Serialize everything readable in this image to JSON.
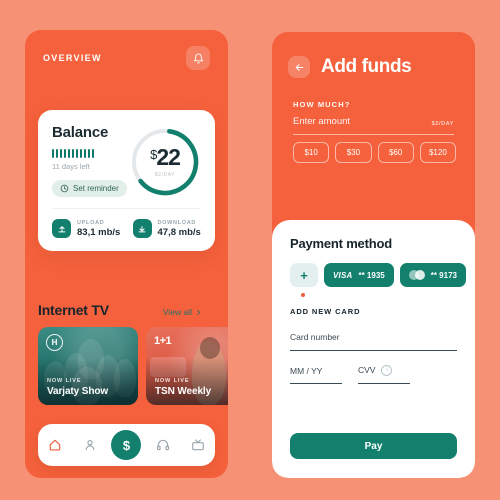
{
  "theme": {
    "page_bg": "#f79175",
    "phone_bg": "#f4613c",
    "accent_teal": "#13806e",
    "accent_coral": "#f4613c",
    "card_white": "#ffffff"
  },
  "left_screen": {
    "header": {
      "title": "OVERVIEW",
      "bell_icon": "bell-icon"
    },
    "balance_card": {
      "title": "Balance",
      "bars_count": 11,
      "days_left": "11 days left",
      "reminder_label": "Set reminder",
      "reminder_icon": "clock-icon",
      "gauge": {
        "currency": "$",
        "amount": "22",
        "rate": "$2/DAY",
        "progress_percent": 62,
        "track_color": "#e4e8ea",
        "fill_color": "#13806e"
      },
      "stats": [
        {
          "label": "UPLOAD",
          "value": "83,1 mb/s",
          "icon": "upload-icon"
        },
        {
          "label": "DOWNLOAD",
          "value": "47,8 mb/s",
          "icon": "download-icon"
        }
      ]
    },
    "tv_section": {
      "title": "Internet TV",
      "view_all": "View all",
      "view_all_icon": "chevron-right-icon",
      "cards": [
        {
          "badge": "H",
          "badge_type": "circle",
          "live": "NOW LIVE",
          "name": "Varjaty Show"
        },
        {
          "badge": "1+1",
          "badge_type": "text",
          "live": "NOW LIVE",
          "name": "TSN Weekly"
        }
      ]
    },
    "bottom_nav": [
      {
        "icon": "home-icon",
        "active": true
      },
      {
        "icon": "person-icon",
        "active": false
      },
      {
        "icon": "dollar-icon",
        "active": false,
        "fab": true,
        "glyph": "$"
      },
      {
        "icon": "headset-icon",
        "active": false
      },
      {
        "icon": "tv-icon",
        "active": false
      }
    ]
  },
  "right_screen": {
    "header": {
      "back_icon": "arrow-left-icon",
      "title": "Add funds"
    },
    "amount": {
      "section_label": "HOW MUCH?",
      "placeholder": "Enter amount",
      "hint": "$2/DAY",
      "quick_amounts": [
        "$10",
        "$30",
        "$60",
        "$120"
      ]
    },
    "payment_method": {
      "title": "Payment method",
      "add_glyph": "+",
      "cards": [
        {
          "brand": "VISA",
          "digits": "** 1935",
          "type": "visa"
        },
        {
          "brand": "",
          "digits": "** 9173",
          "type": "mastercard"
        }
      ]
    },
    "new_card": {
      "section_label": "ADD NEW CARD",
      "card_number_label": "Card number",
      "expiry_label": "MM / YY",
      "cvv_label": "CVV",
      "cvv_info_icon": "info-icon"
    },
    "pay_button": "Pay"
  }
}
